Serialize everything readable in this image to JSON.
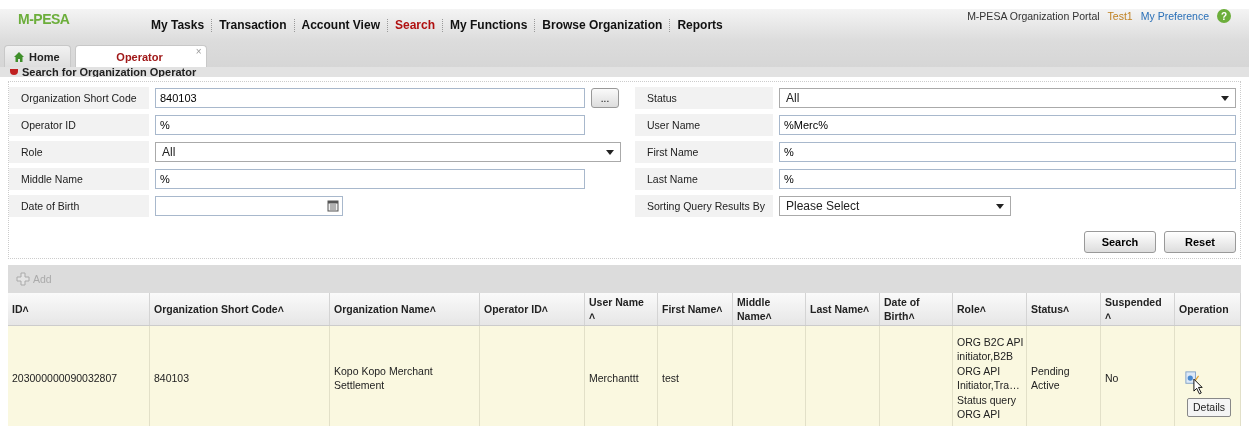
{
  "header": {
    "logo": "M-PESA",
    "menu": [
      {
        "label": "My Tasks",
        "selected": false
      },
      {
        "label": "Transaction",
        "selected": false
      },
      {
        "label": "Account View",
        "selected": false
      },
      {
        "label": "Search",
        "selected": true
      },
      {
        "label": "My Functions",
        "selected": false
      },
      {
        "label": "Browse Organization",
        "selected": false
      },
      {
        "label": "Reports",
        "selected": false
      }
    ],
    "portal": "M-PESA Organization Portal",
    "user": "Test1",
    "preference": "My Preference",
    "help": "?"
  },
  "tabs": [
    {
      "label": "Home",
      "selected": false,
      "kind": "home"
    },
    {
      "label": "Operator",
      "selected": true,
      "kind": "closable",
      "close": "×"
    }
  ],
  "section_title": "Search for Organization Operator",
  "form": {
    "left": [
      {
        "label": "Organization Short Code",
        "kind": "lookup",
        "value": "840103",
        "button": "..."
      },
      {
        "label": "Operator ID",
        "kind": "text",
        "value": "%"
      },
      {
        "label": "Role",
        "kind": "select",
        "value": "All"
      },
      {
        "label": "Middle Name",
        "kind": "text",
        "value": "%"
      },
      {
        "label": "Date of Birth",
        "kind": "date"
      }
    ],
    "right": [
      {
        "label": "Status",
        "kind": "select",
        "value": "All"
      },
      {
        "label": "User Name",
        "kind": "text",
        "value": "%Merc%"
      },
      {
        "label": "First Name",
        "kind": "text",
        "value": "%"
      },
      {
        "label": "Last Name",
        "kind": "text",
        "value": "%"
      },
      {
        "label": "Sorting Query Results By",
        "kind": "short-select",
        "value": "Please Select"
      }
    ],
    "buttons": [
      "Search",
      "Reset"
    ]
  },
  "toolbar": {
    "add": "Add",
    "disabled": true
  },
  "table": {
    "columns": [
      "ID˄",
      "Organization Short Code˄",
      "Organization Name˄",
      "Operator ID˄",
      "User Name\n˄",
      "First Name˄",
      "Middle\nName˄",
      "Last Name˄",
      "Date of\nBirth˄",
      "Role˄",
      "Status˄",
      "Suspended\n˄",
      "Operation"
    ],
    "rows": [
      {
        "cells": [
          "203000000090032807",
          "840103",
          "Kopo Kopo Merchant\nSettlement",
          null,
          "Merchanttt",
          "test",
          null,
          null,
          null,
          "ORG B2C API\ninitiator,B2B\nORG API\nInitiator,Tra…\nStatus query\nORG API",
          "Pending\nActive",
          "No"
        ]
      }
    ]
  },
  "tooltip": "Details"
}
